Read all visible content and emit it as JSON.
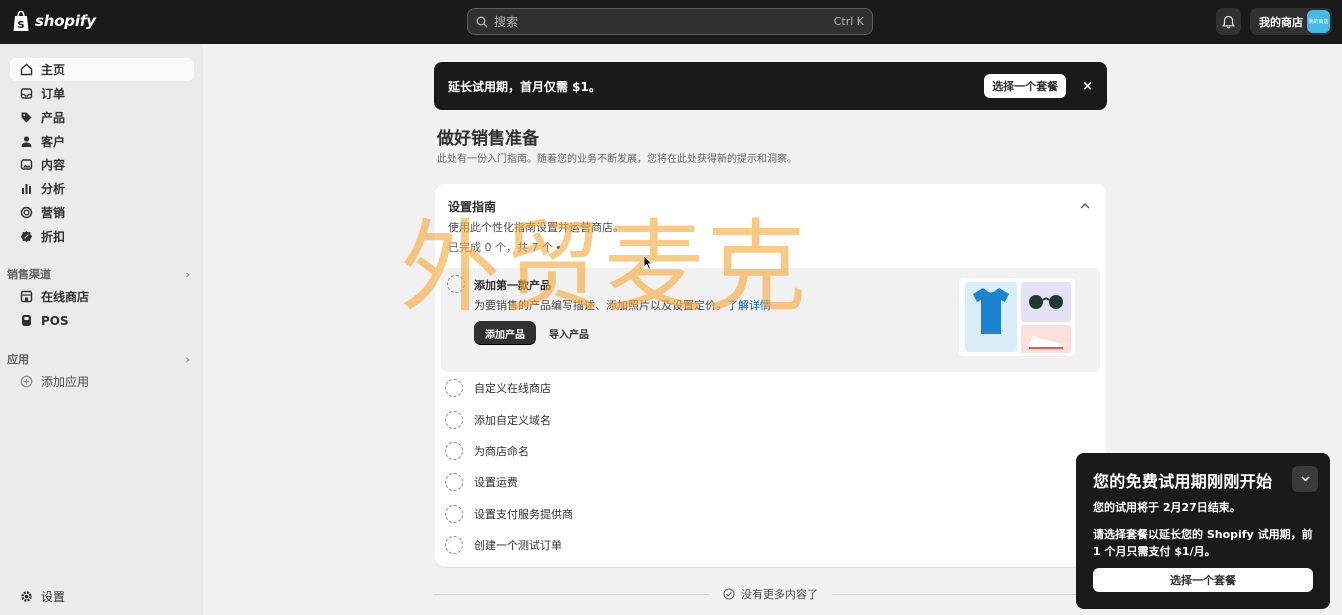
{
  "topbar": {
    "logo_text": "shopify",
    "search_placeholder": "搜索",
    "search_shortcut": "Ctrl K",
    "store_name": "我的商店",
    "avatar_text": "我的商店"
  },
  "sidebar": {
    "items": [
      {
        "label": "主页",
        "icon": "home-icon"
      },
      {
        "label": "订单",
        "icon": "inbox-icon"
      },
      {
        "label": "产品",
        "icon": "tag-icon"
      },
      {
        "label": "客户",
        "icon": "person-icon"
      },
      {
        "label": "内容",
        "icon": "image-icon"
      },
      {
        "label": "分析",
        "icon": "bar-chart-icon"
      },
      {
        "label": "营销",
        "icon": "target-icon"
      },
      {
        "label": "折扣",
        "icon": "discount-icon"
      }
    ],
    "sales_channels_heading": "销售渠道",
    "channels": [
      {
        "label": "在线商店",
        "icon": "store-icon"
      },
      {
        "label": "POS",
        "icon": "pos-icon"
      }
    ],
    "apps_heading": "应用",
    "add_app_label": "添加应用",
    "settings_label": "设置"
  },
  "banner": {
    "text": "延长试用期，首月仅需 $1。",
    "button": "选择一个套餐",
    "close": "×"
  },
  "page": {
    "title": "做好销售准备",
    "subtitle": "此处有一份入门指南。随着您的业务不断发展，您将在此处获得新的提示和洞察。"
  },
  "guide": {
    "title": "设置指南",
    "description": "使用此个性化指南设置并运营商店。",
    "progress": "已完成 0 个，共 7 个",
    "expanded_task": {
      "title": "添加第一款产品",
      "description": "为要销售的产品编写描述、添加照片以及设置定价。",
      "learn_more": "了解详情",
      "primary_button": "添加产品",
      "secondary_button": "导入产品"
    },
    "tasks": [
      "自定义在线商店",
      "添加自定义域名",
      "为商店命名",
      "设置运费",
      "设置支付服务提供商",
      "创建一个测试订单"
    ]
  },
  "end_message": "没有更多内容了",
  "popover": {
    "title": "您的免费试用期刚刚开始",
    "line1_prefix": "您的试用将于 ",
    "line1_date": "2月27日",
    "line1_suffix": "结束。",
    "line2": "请选择套餐以延长您的 Shopify 试用期，前 1 个月只需支付 $1/月。",
    "button": "选择一个套餐"
  },
  "watermark": "外贸麦克",
  "colors": {
    "topbar": "#1a1a1a",
    "sidebar": "#ebebeb",
    "background": "#f1f1f1",
    "link": "#005bd3",
    "watermark": "#f7a839"
  }
}
